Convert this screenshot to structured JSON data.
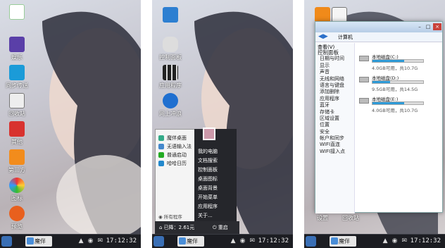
{
  "taskbar": {
    "app_label": "魔伴",
    "clock": "17:12:32"
  },
  "panel1": {
    "icons": [
      {
        "label": ""
      },
      {
        "label": "娱乐"
      },
      {
        "label": "同步传送"
      },
      {
        "label": "回收站"
      },
      {
        "label": "其他"
      },
      {
        "label": "第三方"
      },
      {
        "label": "图标"
      },
      {
        "label": "预览"
      }
    ]
  },
  "panel2": {
    "icons": [
      {
        "label": ""
      },
      {
        "label": "控制面板"
      },
      {
        "label": "应用程序"
      },
      {
        "label": "网上冲浪"
      }
    ],
    "menu_left": [
      "魔伴桌面",
      "无语输入法",
      "普通启动",
      "哈哈日历"
    ],
    "all_programs": "所有程序",
    "menu_right": [
      "我的电脑",
      "文档搜索",
      "控制面板",
      "桌面图标",
      "桌面背景",
      "开始菜单",
      "应用程序",
      "关于..."
    ],
    "footer_used": "已降：2.61元",
    "footer_restart": "重启"
  },
  "panel3": {
    "address": "计算机",
    "view_menu": "查看(V)",
    "tree": [
      "控制面板",
      "日期与时间",
      "显示",
      "声音",
      "无线和网络",
      "语言与键盘",
      "添加删除",
      "应用程序",
      "蓝牙",
      "存储卡",
      "区域设置",
      "位置",
      "安全",
      "帐户和同步",
      "WIFI直连",
      "WIFI接入点"
    ],
    "drives": [
      {
        "name": "本地磁盘(C:)",
        "info": "4.0GB可用，共10.7G",
        "fill": 0.62
      },
      {
        "name": "本地磁盘(D:)",
        "info": "9.5GB可用，共14.5G",
        "fill": 0.35
      },
      {
        "name": "本地磁盘(E:)",
        "info": "4.0GB可用，共10.7G",
        "fill": 0.62
      }
    ],
    "bottom_icons": [
      "设置",
      "回收站"
    ]
  }
}
